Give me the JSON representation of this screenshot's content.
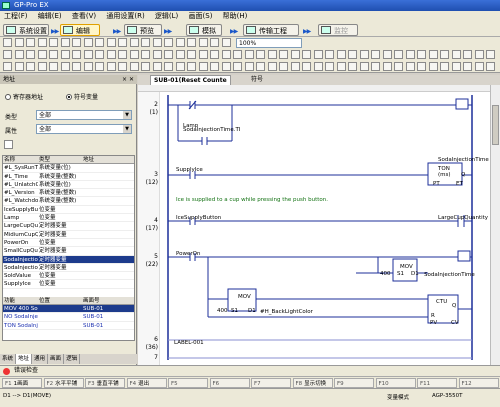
{
  "window": {
    "title": "GP-Pro EX"
  },
  "menu": [
    "工程(F)",
    "编辑(E)",
    "查看(V)",
    "通用设置(R)",
    "逻辑(L)",
    "画面(S)",
    "帮助(H)"
  ],
  "modes": {
    "system": "系统设置",
    "edit": "编辑",
    "preview": "预览",
    "simulate": "模拟",
    "transfer": "传输工程",
    "monitor": "监控"
  },
  "toolbar": {
    "zoom": "100%"
  },
  "addr_panel": {
    "title": "地址",
    "radio_device": "寄存器地址",
    "radio_symbol": "符号变量",
    "type_label": "类型",
    "type_value": "全部",
    "attr_label": "属性",
    "attr_value": "全部",
    "columns": [
      "名称",
      "类型",
      "地址"
    ],
    "rows": [
      [
        "#L_SysRunTi",
        "系统变量(位)",
        ""
      ],
      [
        "#L_Time",
        "系统变量(整数)",
        ""
      ],
      [
        "#L_UnlatchCle",
        "系统变量(位)",
        ""
      ],
      [
        "#L_Version",
        "系统变量(整数)",
        ""
      ],
      [
        "#L_WatchdogT",
        "系统变量(整数)",
        ""
      ],
      [
        "IceSupplyButton",
        "位变量",
        ""
      ],
      [
        "Lamp",
        "位变量",
        ""
      ],
      [
        "LargeCupQuant",
        "定时器变量",
        ""
      ],
      [
        "MidiumCupQuan",
        "定时器变量",
        ""
      ],
      [
        "PowerOn",
        "位变量",
        ""
      ],
      [
        "SmallCupQuant",
        "定时器变量",
        ""
      ],
      [
        "SodaInjectionTi",
        "定时器变量",
        ""
      ],
      [
        "SodaInjectionTir",
        "定时器变量",
        ""
      ],
      [
        "SoldValue",
        "位变量",
        ""
      ],
      [
        "SupplyIce",
        "位变量",
        ""
      ]
    ],
    "selected_row": 11,
    "ref_columns": [
      "功能",
      "位置",
      "画面号"
    ],
    "ref_rows": [
      [
        "MOV 400 Sodal 5",
        "SUB-01"
      ],
      [
        "NO SodaInject 2",
        "SUB-01"
      ],
      [
        "TON SodaInject 3",
        "SUB-01"
      ]
    ],
    "tabs": [
      "系统",
      "地址",
      "通用",
      "画面",
      "逻辑"
    ]
  },
  "editor": {
    "tab_active": "SUB-01(Reset Counte",
    "tab_other": "符号",
    "rungs": [
      {
        "num": "2",
        "sub": "(1)"
      },
      {
        "num": "3",
        "sub": "(12)"
      },
      {
        "num": "4",
        "sub": "(17)"
      },
      {
        "num": "5",
        "sub": "(22)"
      },
      {
        "num": "6",
        "sub": "(36)"
      },
      {
        "num": "7",
        "sub": ""
      }
    ],
    "labels": {
      "lamp": "Lamp",
      "soda_time": "SodaInjectionTime.TI",
      "supply_ice": "SupplyIce",
      "soda_time_q": "SodaInjectionTime",
      "ton": "TON",
      "ms": "(ms)",
      "q": "Q",
      "pt": "PT",
      "et": "ET",
      "comment": "Ice is supplied to a cup while pressing the push button.",
      "ice_button": "IceSupplyButton",
      "large_cup": "LargeCupQuantity",
      "power_on": "PowerOn",
      "mov1": "MOV",
      "mov_400": "400",
      "s1": "S1",
      "d1": "D1",
      "soda_time_d": "SodaInjectionTime",
      "mov2": "MOV",
      "mov2_400": "400",
      "mov2_s1": "S1",
      "mov2_d1": "D1",
      "backlight": "#H_BackLightColor",
      "ctu": "CTU",
      "ctu_q": "Q",
      "ctu_r": "R",
      "ctu_pv": "PV",
      "ctu_cv": "CV",
      "label_001": "LABEL-001"
    }
  },
  "errbar": "错误检查",
  "fkeys": [
    [
      "F1",
      "1画面"
    ],
    [
      "F2",
      "水平平铺"
    ],
    [
      "F3",
      "垂直平铺"
    ],
    [
      "F4",
      "退出"
    ],
    [
      "F5",
      ""
    ],
    [
      "F6",
      ""
    ],
    [
      "F7",
      ""
    ],
    [
      "F8",
      "显示切换"
    ],
    [
      "F9",
      ""
    ],
    [
      "F10",
      ""
    ],
    [
      "F11",
      ""
    ],
    [
      "F12",
      ""
    ]
  ],
  "status": {
    "left": "D1 --> D1(MOVE)",
    "mode_label": "变量模式",
    "model": "AGP-3550T"
  }
}
